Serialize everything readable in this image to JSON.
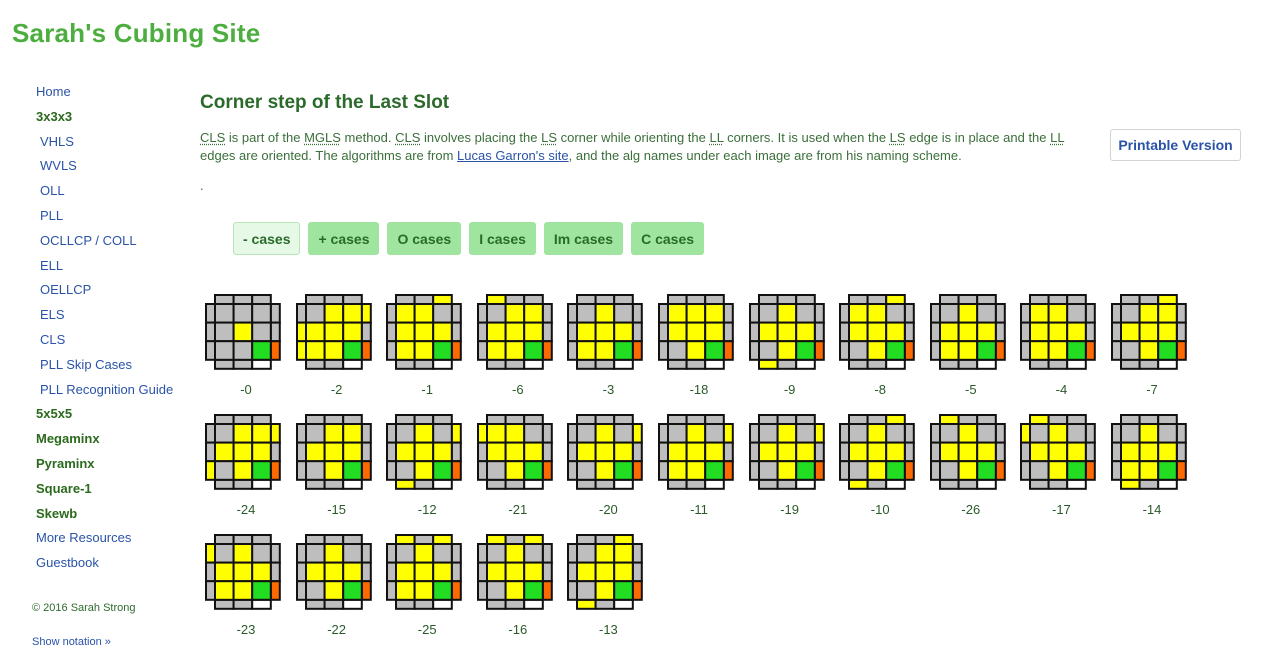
{
  "site_title": "Sarah's Cubing Site",
  "sidebar": {
    "items": [
      {
        "label": "Home",
        "kind": "top"
      },
      {
        "label": "3x3x3",
        "kind": "section"
      },
      {
        "label": "VHLS",
        "kind": "sub"
      },
      {
        "label": "WVLS",
        "kind": "sub"
      },
      {
        "label": "OLL",
        "kind": "sub"
      },
      {
        "label": "PLL",
        "kind": "sub"
      },
      {
        "label": "OCLLCP / COLL",
        "kind": "sub"
      },
      {
        "label": "ELL",
        "kind": "sub"
      },
      {
        "label": "OELLCP",
        "kind": "sub"
      },
      {
        "label": "ELS",
        "kind": "sub"
      },
      {
        "label": "CLS",
        "kind": "sub"
      },
      {
        "label": "PLL Skip Cases",
        "kind": "sub"
      },
      {
        "label": "PLL Recognition Guide",
        "kind": "sub"
      },
      {
        "label": "5x5x5",
        "kind": "section"
      },
      {
        "label": "Megaminx",
        "kind": "section"
      },
      {
        "label": "Pyraminx",
        "kind": "section"
      },
      {
        "label": "Square-1",
        "kind": "section"
      },
      {
        "label": "Skewb",
        "kind": "section"
      },
      {
        "label": "More Resources",
        "kind": "top"
      },
      {
        "label": "Guestbook",
        "kind": "top"
      }
    ],
    "copyright": "© 2016 Sarah Strong",
    "show_notation": "Show notation »"
  },
  "page": {
    "title": "Corner step of the Last Slot",
    "intro": {
      "t1": "CLS",
      "t2": " is part of the ",
      "t3": "MGLS",
      "t4": " method. ",
      "t5": "CLS",
      "t6": " involves placing the ",
      "t7": "LS",
      "t8": " corner while orienting the ",
      "t9": "LL",
      "t10": " corners. It is used when the ",
      "t11": "LS",
      "t12": " edge is in place and the ",
      "t13": "LL",
      "t14": " edges are oriented. The algorithms are from ",
      "link": "Lucas Garron's site",
      "t15": ", and the alg names under each image are from his naming scheme."
    },
    "dot": ".",
    "printable_button": "Printable Version",
    "filters": [
      "- cases",
      "+ cases",
      "O cases",
      "I cases",
      "Im cases",
      "C cases"
    ],
    "active_filter": 0
  },
  "colors": {
    "yellow": "#ffff00",
    "gray": "#bebebe",
    "green": "#22dd22",
    "orange": "#ff6a00",
    "white": "#ffffff",
    "border": "#111111"
  },
  "cases": [
    {
      "label": "-0",
      "top": "GGGGYGGGG",
      "lt": "GGG",
      "rt": "GGG",
      "bk": "GGG",
      "fr": "GGW"
    },
    {
      "label": "-2",
      "top": "GYYYYYYYG",
      "lt": "GYY",
      "rt": "YGG",
      "bk": "GGG",
      "fr": "GGW"
    },
    {
      "label": "-1",
      "top": "YYGYYYYYY",
      "lt": "GGG",
      "rt": "GGG",
      "bk": "GGY",
      "fr": "GGW"
    },
    {
      "label": "-6",
      "top": "GYYYYYYYY",
      "lt": "GGG",
      "rt": "GGG",
      "bk": "YGG",
      "fr": "GGW"
    },
    {
      "label": "-3",
      "top": "GYGYYYYYY",
      "lt": "GGG",
      "rt": "GGG",
      "bk": "GGG",
      "fr": "GGW"
    },
    {
      "label": "-18",
      "top": "YYYYYYGYY",
      "lt": "GGG",
      "rt": "GGG",
      "bk": "GGG",
      "fr": "GGW"
    },
    {
      "label": "-9",
      "top": "GYGYYYGYY",
      "lt": "GGG",
      "rt": "GGG",
      "bk": "GGG",
      "fr": "YGW"
    },
    {
      "label": "-8",
      "top": "YYGYYYGYY",
      "lt": "GGG",
      "rt": "GGG",
      "bk": "GGY",
      "fr": "GGW"
    },
    {
      "label": "-5",
      "top": "GYGYYYYYY",
      "lt": "GGG",
      "rt": "GGY",
      "bk": "GGG",
      "fr": "GGW"
    },
    {
      "label": "-4",
      "top": "YYGYYYYYY",
      "lt": "GGG",
      "rt": "GGG",
      "bk": "GGG",
      "fr": "GGW"
    },
    {
      "label": "-7",
      "top": "GYYYYYGYY",
      "lt": "GGG",
      "rt": "GGG",
      "bk": "GGY",
      "fr": "GGW"
    },
    {
      "label": "-24",
      "top": "GYYYYYGYY",
      "lt": "GGY",
      "rt": "YGG",
      "bk": "GGG",
      "fr": "GGW"
    },
    {
      "label": "-15",
      "top": "GYYYYYGYY",
      "lt": "GGG",
      "rt": "GGG",
      "bk": "GGG",
      "fr": "GGW"
    },
    {
      "label": "-12",
      "top": "GYGYYYGYY",
      "lt": "GGG",
      "rt": "YGG",
      "bk": "GGG",
      "fr": "YGW"
    },
    {
      "label": "-21",
      "top": "YYGYYYGYY",
      "lt": "YGG",
      "rt": "GGG",
      "bk": "GGG",
      "fr": "GGW"
    },
    {
      "label": "-20",
      "top": "GYGYYYGYY",
      "lt": "GGG",
      "rt": "YGG",
      "bk": "GGG",
      "fr": "GGW"
    },
    {
      "label": "-11",
      "top": "GYGYYYYYY",
      "lt": "GGG",
      "rt": "YGG",
      "bk": "GGG",
      "fr": "GGW"
    },
    {
      "label": "-19",
      "top": "GYGYYYGYY",
      "lt": "GGG",
      "rt": "YGY",
      "bk": "GGG",
      "fr": "GGW"
    },
    {
      "label": "-10",
      "top": "GYGYYYGYY",
      "lt": "GGG",
      "rt": "GGG",
      "bk": "GGY",
      "fr": "YGW"
    },
    {
      "label": "-26",
      "top": "GYGYYYGYY",
      "lt": "GGG",
      "rt": "GGG",
      "bk": "YGG",
      "fr": "GGW"
    },
    {
      "label": "-17",
      "top": "GYGYYYGYY",
      "lt": "YGG",
      "rt": "GGG",
      "bk": "YGG",
      "fr": "GGW"
    },
    {
      "label": "-14",
      "top": "GYGYYYYYY",
      "lt": "GGG",
      "rt": "GGY",
      "bk": "GGG",
      "fr": "YGW"
    },
    {
      "label": "-23",
      "top": "GYGYYYYYY",
      "lt": "YGG",
      "rt": "GGG",
      "bk": "GGG",
      "fr": "GGW"
    },
    {
      "label": "-22",
      "top": "GYGYYYGYY",
      "lt": "GGG",
      "rt": "GGY",
      "bk": "GGG",
      "fr": "GGW"
    },
    {
      "label": "-25",
      "top": "GYGYYYYYY",
      "lt": "GGG",
      "rt": "GGG",
      "bk": "YGY",
      "fr": "GGW"
    },
    {
      "label": "-16",
      "top": "GYGYYYGYY",
      "lt": "GGG",
      "rt": "GGG",
      "bk": "YGY",
      "fr": "GGW"
    },
    {
      "label": "-13",
      "top": "GYYYYYGYY",
      "lt": "GGG",
      "rt": "GGG",
      "bk": "GGY",
      "fr": "YGW"
    }
  ]
}
